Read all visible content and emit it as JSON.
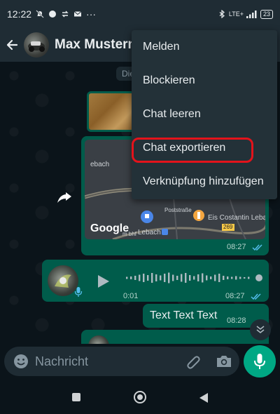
{
  "status_bar": {
    "time": "12:22",
    "network": "LTE+",
    "battery": "23",
    "more_indicator": "···"
  },
  "header": {
    "back_icon": "arrow-left-icon",
    "contact_name": "Max Musterm"
  },
  "chat": {
    "date_chip": "Die",
    "map_message": {
      "labels": {
        "place_left": "ebach",
        "street": "Poststraße",
        "shop": "Eis Costantin Lebac",
        "town": "Lebach",
        "road_number": "269",
        "corner": "m bhf"
      },
      "logo_text": "Google",
      "time": "08:27",
      "status": "read"
    },
    "voice_message": {
      "duration": "0:01",
      "time": "08:27",
      "status": "read"
    },
    "text_message": {
      "text": "Text Text Text",
      "time": "08:28"
    }
  },
  "input": {
    "placeholder": "Nachricht"
  },
  "menu": {
    "items": [
      {
        "label": "Melden"
      },
      {
        "label": "Blockieren"
      },
      {
        "label": "Chat leeren"
      },
      {
        "label": "Chat exportieren"
      },
      {
        "label": "Verknüpfung hinzufügen"
      }
    ],
    "highlighted_item": "Chat exportieren",
    "highlight_color": "#e3131b"
  },
  "colors": {
    "outgoing_bubble": "#005c4b",
    "accent": "#00a884",
    "read_ticks": "#53bdeb",
    "app_bar": "#1f2c34"
  }
}
